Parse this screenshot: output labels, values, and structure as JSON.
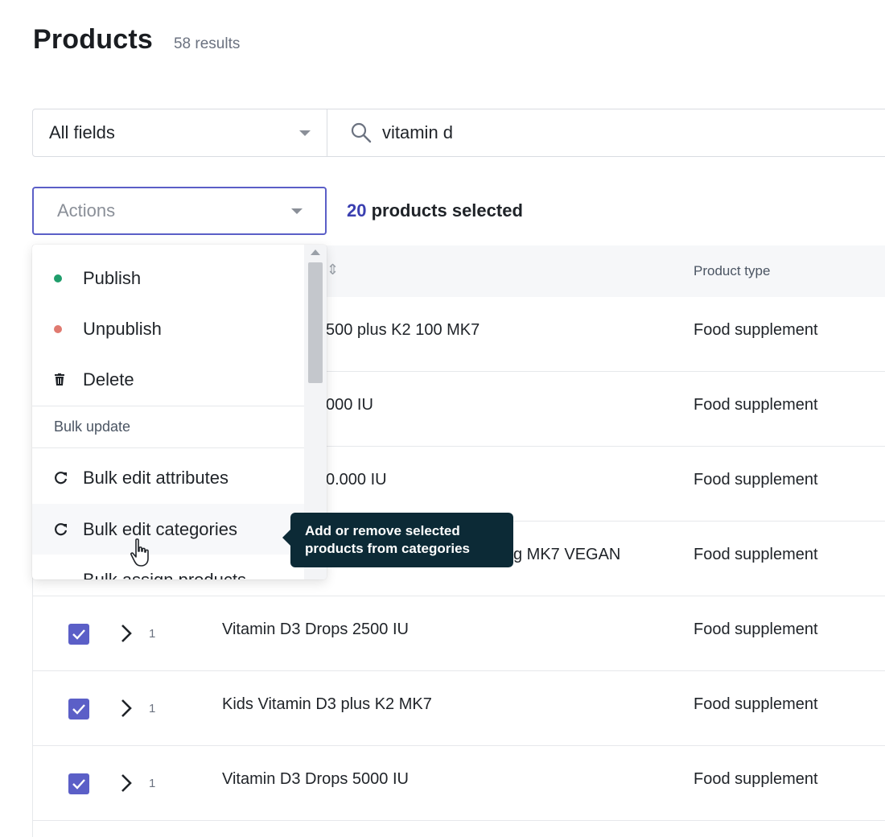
{
  "header": {
    "title": "Products",
    "results": "58 results"
  },
  "filter": {
    "field_label": "All fields",
    "search_value": "vitamin d"
  },
  "actions": {
    "placeholder": "Actions",
    "selected_count": "20",
    "selected_text": "products selected"
  },
  "table": {
    "sort_icon": "⇕",
    "header_type": "Product type",
    "rows": [
      {
        "name": "500 plus K2 100 MK7",
        "type": "Food supplement"
      },
      {
        "name": "000 IU",
        "type": "Food supplement"
      },
      {
        "name": "0.000 IU",
        "type": "Food supplement"
      },
      {
        "name": "g MK7 VEGAN",
        "type": "Food supplement"
      },
      {
        "variants": "1",
        "name": "Vitamin D3 Drops 2500 IU",
        "type": "Food supplement"
      },
      {
        "variants": "1",
        "name": "Kids Vitamin D3 plus K2 MK7",
        "type": "Food supplement"
      },
      {
        "variants": "1",
        "name": "Vitamin D3 Drops 5000 IU",
        "type": "Food supplement"
      }
    ]
  },
  "menu": {
    "items": [
      {
        "label": "Publish",
        "icon": "green-dot-icon",
        "color": "#1f9d6b"
      },
      {
        "label": "Unpublish",
        "icon": "red-dot-icon",
        "color": "#e07a70"
      },
      {
        "label": "Delete",
        "icon": "trash-icon"
      }
    ],
    "section": "Bulk update",
    "bulk_items": [
      {
        "label": "Bulk edit attributes",
        "icon": "refresh-icon"
      },
      {
        "label": "Bulk edit categories",
        "icon": "refresh-icon"
      },
      {
        "label": "Bulk assign products",
        "icon": "refresh-icon"
      }
    ]
  },
  "tooltip": {
    "text_line1": "Add or remove selected",
    "text_line2": "products from categories"
  },
  "colors": {
    "accent": "#5b5fc7",
    "tooltip_bg": "#0c2a36"
  }
}
